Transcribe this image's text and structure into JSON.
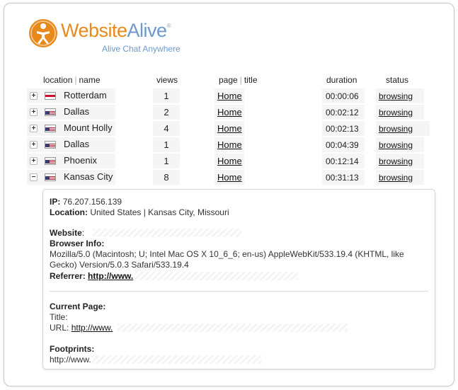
{
  "logo": {
    "word_part1": "Website",
    "word_part2": "Alive",
    "reg": "®",
    "tagline": "Alive Chat Anywhere",
    "icon": "person-figure-icon",
    "colors": {
      "orange": "#e8891c",
      "blue": "#6d9acb"
    }
  },
  "table": {
    "headers": {
      "location": "location",
      "name": "name",
      "views": "views",
      "page": "page",
      "title": "title",
      "duration": "duration",
      "status": "status"
    },
    "rows": [
      {
        "toggle": "+",
        "flag": "netherlands-flag-icon",
        "city": "Rotterdam",
        "views": "1",
        "page": "Home",
        "duration": "00:00:06",
        "status": "browsing"
      },
      {
        "toggle": "+",
        "flag": "us-flag-icon",
        "city": "Dallas",
        "views": "2",
        "page": "Home",
        "duration": "00:02:12",
        "status": "browsing"
      },
      {
        "toggle": "+",
        "flag": "us-flag-icon",
        "city": "Mount Holly",
        "views": "4",
        "page": "Home",
        "duration": "00:02:13",
        "status": "browsing"
      },
      {
        "toggle": "+",
        "flag": "us-flag-icon",
        "city": "Dallas",
        "views": "1",
        "page": "Home",
        "duration": "00:04:39",
        "status": "browsing"
      },
      {
        "toggle": "+",
        "flag": "us-flag-icon",
        "city": "Phoenix",
        "views": "1",
        "page": "Home",
        "duration": "00:12:14",
        "status": "browsing"
      },
      {
        "toggle": "−",
        "flag": "us-flag-icon",
        "city": "Kansas City",
        "views": "8",
        "page": "Home",
        "duration": "00:31:13",
        "status": "browsing"
      }
    ]
  },
  "details": {
    "ip_label": "IP:",
    "ip_value": "76.207.156.139",
    "location_label": "Location:",
    "location_value": "United States | Kansas City, Missouri",
    "website_label": "Website",
    "website_colon": ":",
    "browser_label": "Browser Info:",
    "browser_line1": "Mozilla/5.0 (Macintosh; U; Intel Mac OS X 10_6_6; en-us) AppleWebKit/533.19.4 (KHTML, like",
    "browser_line2": "Gecko) Version/5.0.3 Safari/533.19.4",
    "referrer_label": "Referrer:",
    "referrer_value": "http://www.",
    "current_page_label": "Current Page:",
    "title_label": "Title:",
    "url_label": "URL:",
    "url_value": "http://www.",
    "footprints_label": "Footprints:",
    "footprints_value": "http://www."
  }
}
